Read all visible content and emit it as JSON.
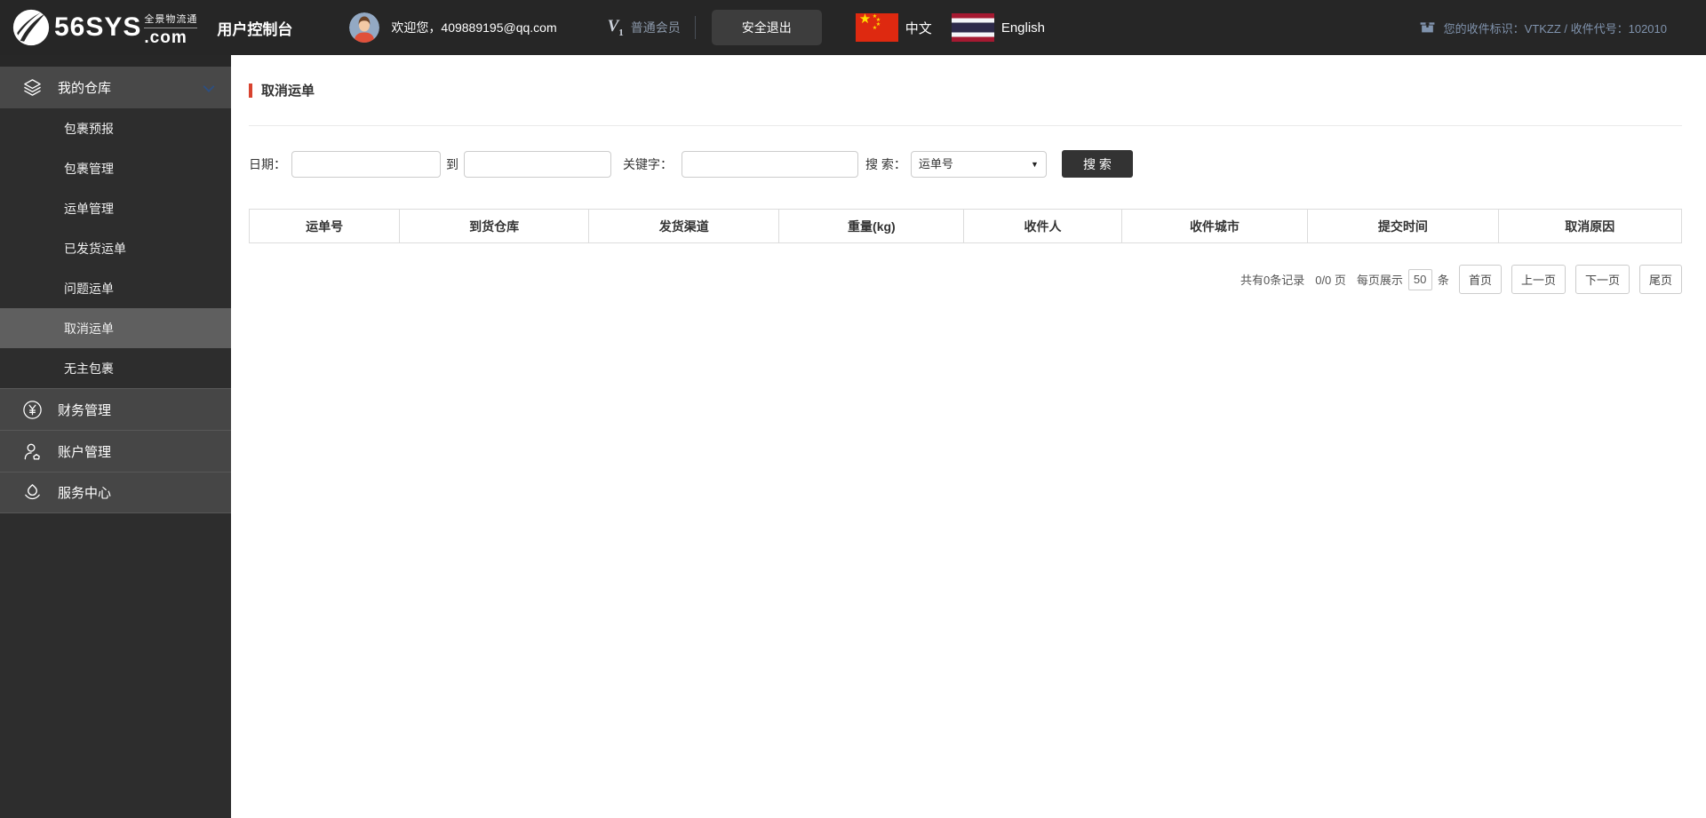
{
  "colors": {
    "accent": "#d8432f",
    "header_bg": "#262626",
    "sidebar_bg": "#2d2d2d",
    "sidebar_parent_bg": "#484848",
    "sidebar_active_bg": "#5f5f5f",
    "search_button_bg": "#333333",
    "muted_blue_text": "#8093ad",
    "cn_flag_red": "#de2910",
    "cn_flag_yellow": "#ffde00"
  },
  "header": {
    "brand": "56SYS",
    "brand_tld": ".com",
    "brand_tagline": "全景物流通",
    "console_title": "用户控制台",
    "welcome_text": "欢迎您，409889195@qq.com",
    "member_v": "V",
    "member_sub": "1",
    "member_level": "普通会员",
    "logout_button": "安全退出",
    "lang_chinese": "中文",
    "lang_english": "English",
    "receiver_info": "您的收件标识：VTKZZ / 收件代号：102010"
  },
  "sidebar": {
    "warehouse": "我的仓库",
    "submenu": [
      "包裹预报",
      "包裹管理",
      "运单管理",
      "已发货运单",
      "问题运单",
      "取消运单",
      "无主包裹"
    ],
    "active_item": "取消运单",
    "finance": "财务管理",
    "account": "账户管理",
    "service": "服务中心"
  },
  "main": {
    "page_title": "取消运单",
    "search": {
      "date_label": "日期：",
      "to_label": "到",
      "keyword_label": "关键字：",
      "search_by_label": "搜 索：",
      "search_type_selected": "运单号",
      "search_button": "搜 索"
    },
    "table": {
      "columns": [
        "运单号",
        "到货仓库",
        "发货渠道",
        "重量(kg)",
        "收件人",
        "收件城市",
        "提交时间",
        "取消原因"
      ]
    },
    "pagination": {
      "total_text": "共有0条记录",
      "page_text": "0/0 页",
      "per_page_prefix": "每页展示",
      "per_page_value": "50",
      "per_page_suffix": "条",
      "first_button": "首页",
      "prev_button": "上一页",
      "next_button": "下一页",
      "last_button": "尾页"
    }
  }
}
